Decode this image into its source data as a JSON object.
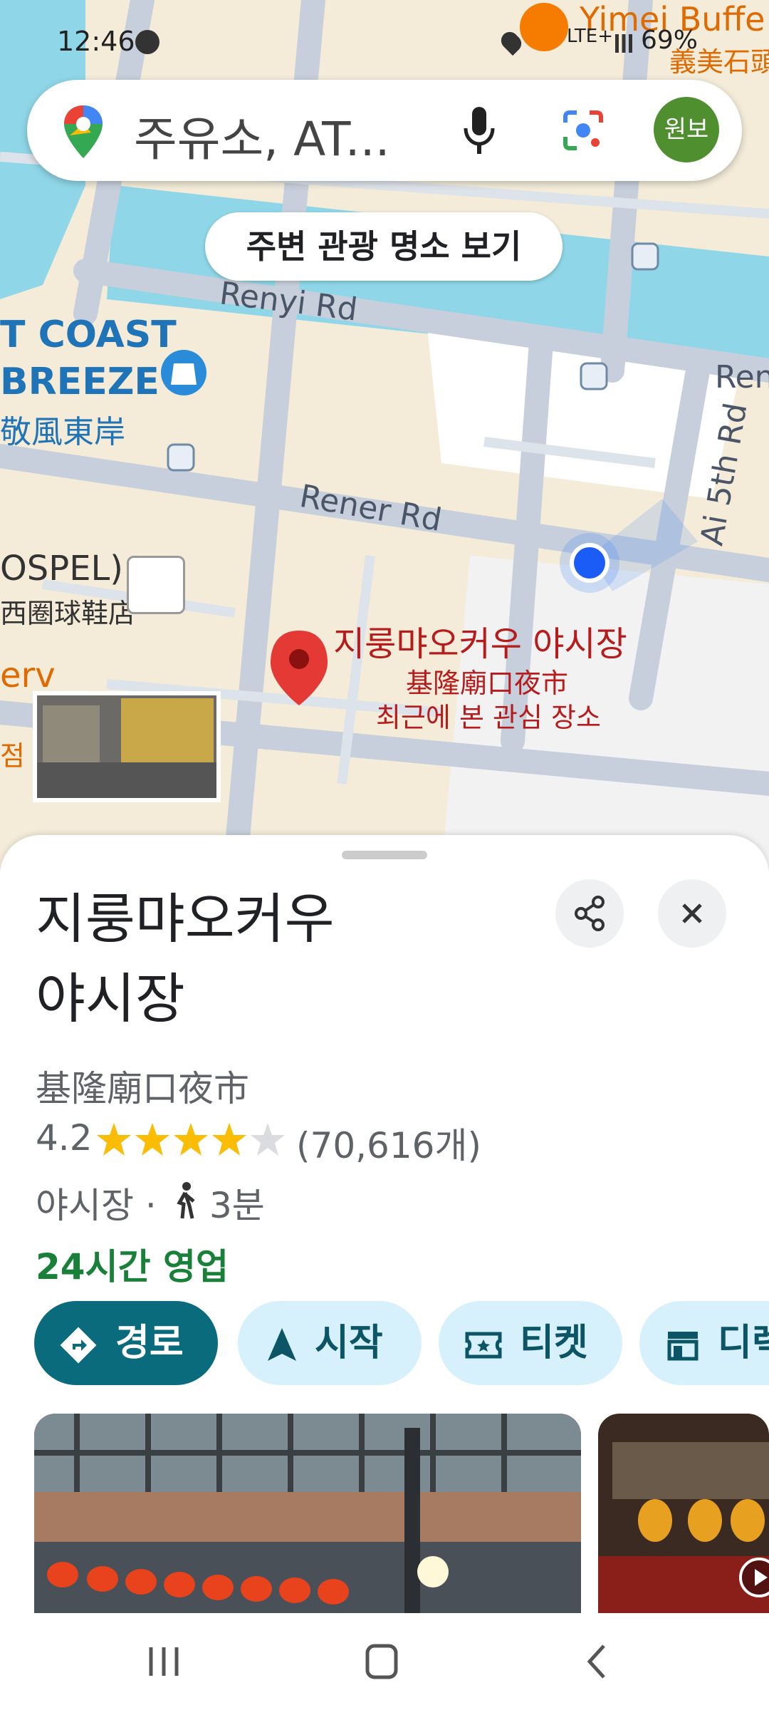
{
  "status_bar": {
    "time": "12:46",
    "network": "LTE+",
    "battery": "69%"
  },
  "search": {
    "placeholder": "주유소, AT...",
    "avatar_text": "원보"
  },
  "map": {
    "nearby_chip": "주변 관광 명소 보기",
    "roads": {
      "renyi": "Renyi Rd",
      "rener": "Rener Rd",
      "ai5th": "Ai 5th Rd",
      "ren_partial": "Ren"
    },
    "poi_coast_1": "T COAST",
    "poi_coast_2": "BREEZE",
    "poi_coast_zh": "敬風東岸",
    "poi_gospel": "OSPEL)",
    "poi_shoe_zh": "西圈球鞋店",
    "poi_yimei": "Yimei Buffe",
    "poi_yimei_zh": "義美石頭",
    "poi_serv": "erv",
    "poi_partial_zh": "점",
    "marker_name": "지룽먀오커우 야시장",
    "marker_zh": "基隆廟口夜市",
    "marker_note": "최근에 본 관심 장소"
  },
  "place": {
    "title_line1": "지룽먀오커우",
    "title_line2": "야시장",
    "name_zh": "基隆廟口夜市",
    "rating": "4.2",
    "reviews": "(70,616개)",
    "category": "야시장 ·",
    "walk_time": "3분",
    "hours": "24시간 영업",
    "actions": {
      "directions": "경로",
      "start": "시작",
      "tickets": "티켓",
      "more": "디렉"
    }
  },
  "colors": {
    "primary": "#0a6b7c",
    "chip_bg": "#d6f1fb",
    "open_green": "#188038",
    "marker_red": "#e53935",
    "star": "#fbbc04"
  }
}
